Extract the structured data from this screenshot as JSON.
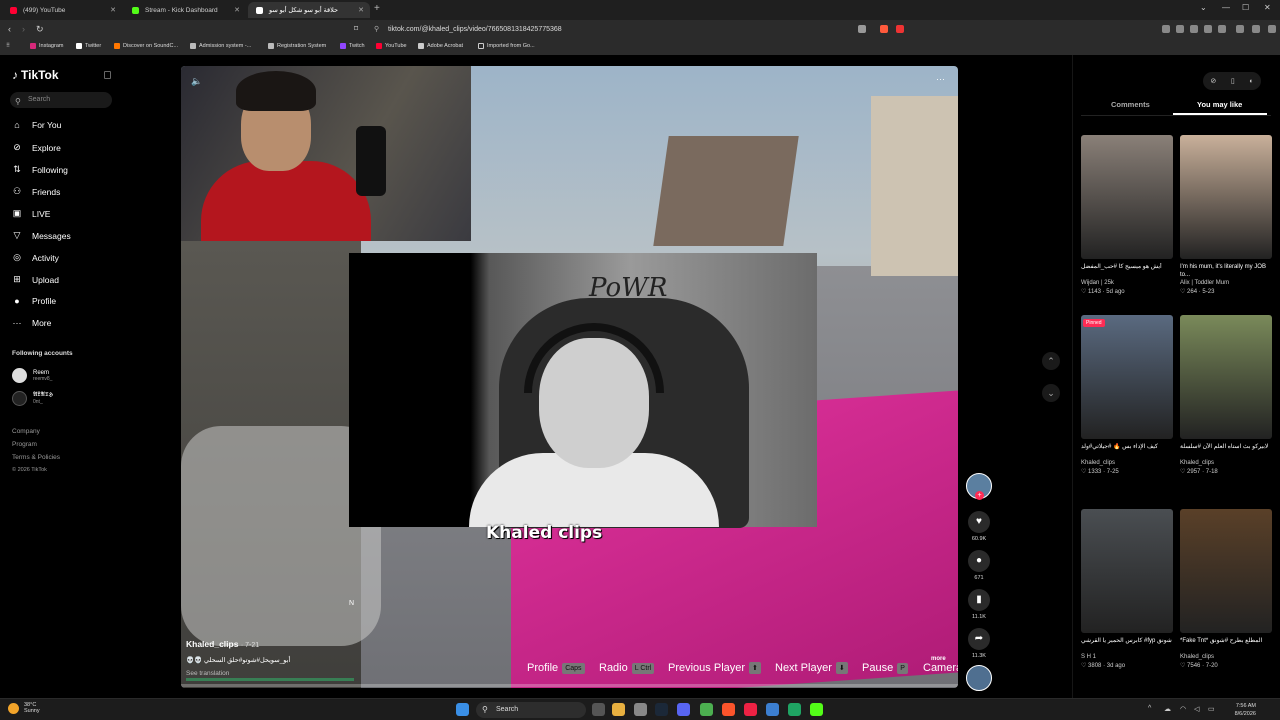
{
  "browser": {
    "tabs": [
      {
        "title": "(499) YouTube",
        "color": "#ff0033"
      },
      {
        "title": "Stream - Kick Dashboard",
        "color": "#53fc18"
      },
      {
        "title": "حلاقة أبو سو شكل أبو سو",
        "color": "#ffffff"
      }
    ],
    "new_tab": "+",
    "url": "tiktok.com/@khaled_clips/video/7665081318425775368",
    "bookmarks": [
      "Instagram",
      "Twitter",
      "Discover on SoundC...",
      "Admission system -...",
      "Registration System",
      "Twitch",
      "YouTube",
      "Adobe Acrobat",
      "Imported from Go..."
    ]
  },
  "sidebar": {
    "logo": "TikTok",
    "search_placeholder": "Search",
    "nav": [
      {
        "label": "For You",
        "icon": "home-icon"
      },
      {
        "label": "Explore",
        "icon": "compass-icon"
      },
      {
        "label": "Following",
        "icon": "following-icon"
      },
      {
        "label": "Friends",
        "icon": "friends-icon"
      },
      {
        "label": "LIVE",
        "icon": "live-icon"
      },
      {
        "label": "Messages",
        "icon": "messages-icon"
      },
      {
        "label": "Activity",
        "icon": "activity-icon"
      },
      {
        "label": "Upload",
        "icon": "upload-icon"
      },
      {
        "label": "Profile",
        "icon": "profile-icon"
      },
      {
        "label": "More",
        "icon": "more-icon"
      }
    ],
    "following_title": "Following accounts",
    "accounts": [
      {
        "name": "Reem",
        "handle": "reemv8_"
      },
      {
        "name": "𝕬𝕷𝕬𝕿𝕳",
        "handle": "0nt_"
      }
    ],
    "footer": [
      "Company",
      "Program",
      "Terms & Policies",
      "© 2026 TikTok"
    ]
  },
  "video": {
    "watermark": "Khaled clips",
    "creator": "Khaled_clips",
    "date": "· 7-21",
    "caption": "💀💀 أبو_سويحل#شوتو#حلق السحلي",
    "see_translation": "See translation",
    "hud": [
      {
        "label": "Profile",
        "key": "Caps"
      },
      {
        "label": "Radio",
        "key": "L Ctrl"
      },
      {
        "label": "Previous Player",
        "key": "⬆"
      },
      {
        "label": "Next Player",
        "key": "⬇"
      },
      {
        "label": "Pause",
        "key": "P"
      },
      {
        "label": "Camera",
        "key": ""
      }
    ],
    "more": "more",
    "progress": 0.0,
    "compass_label": "N"
  },
  "actions": {
    "likes": "60.9K",
    "comments": "671",
    "saves": "11.1K",
    "shares": "11.3K"
  },
  "right_panel": {
    "tabs": [
      "Comments",
      "You may like"
    ],
    "active_tab": "You may like",
    "cards": [
      {
        "title": "أيش هو ميسيج كا #حب_المفضل",
        "author": "Wijdan | 25k",
        "likes": "1143",
        "date": "5d ago",
        "color": "#8a8078",
        "pinned": false
      },
      {
        "title": "I'm his mum, it's literally my JOB to...",
        "author": "Alix | Toddler Mum",
        "likes": "264",
        "date": "5-23",
        "color": "#c9b09a",
        "pinned": false
      },
      {
        "title": "كيف الإداء بس 🔥 #جيلاتي#ولد",
        "author": "Khaled_clips",
        "likes": "1333",
        "date": "7-25",
        "color": "#5a6a80",
        "pinned": true
      },
      {
        "title": "لابيركو بث استاه العلم الآن #سلسلة",
        "author": "Khaled_clips",
        "likes": "2957",
        "date": "7-18",
        "color": "#7a8a5a",
        "pinned": false
      },
      {
        "title": "كابرس الحمير يا القرشي #fyp شونق",
        "author": "S H 1",
        "likes": "3808",
        "date": "3d ago",
        "color": "#4a4e52",
        "pinned": false
      },
      {
        "title": "*Fake Tnt* المطلع بطرح #شونق",
        "author": "Khaled_clips",
        "likes": "7546",
        "date": "7-20",
        "color": "#5a4028",
        "pinned": false
      }
    ],
    "pinned_label": "Pinned"
  },
  "taskbar": {
    "temp": "38°C",
    "weather": "Sunny",
    "search": "Search",
    "time": "7:56 AM",
    "date": "8/6/2026"
  }
}
